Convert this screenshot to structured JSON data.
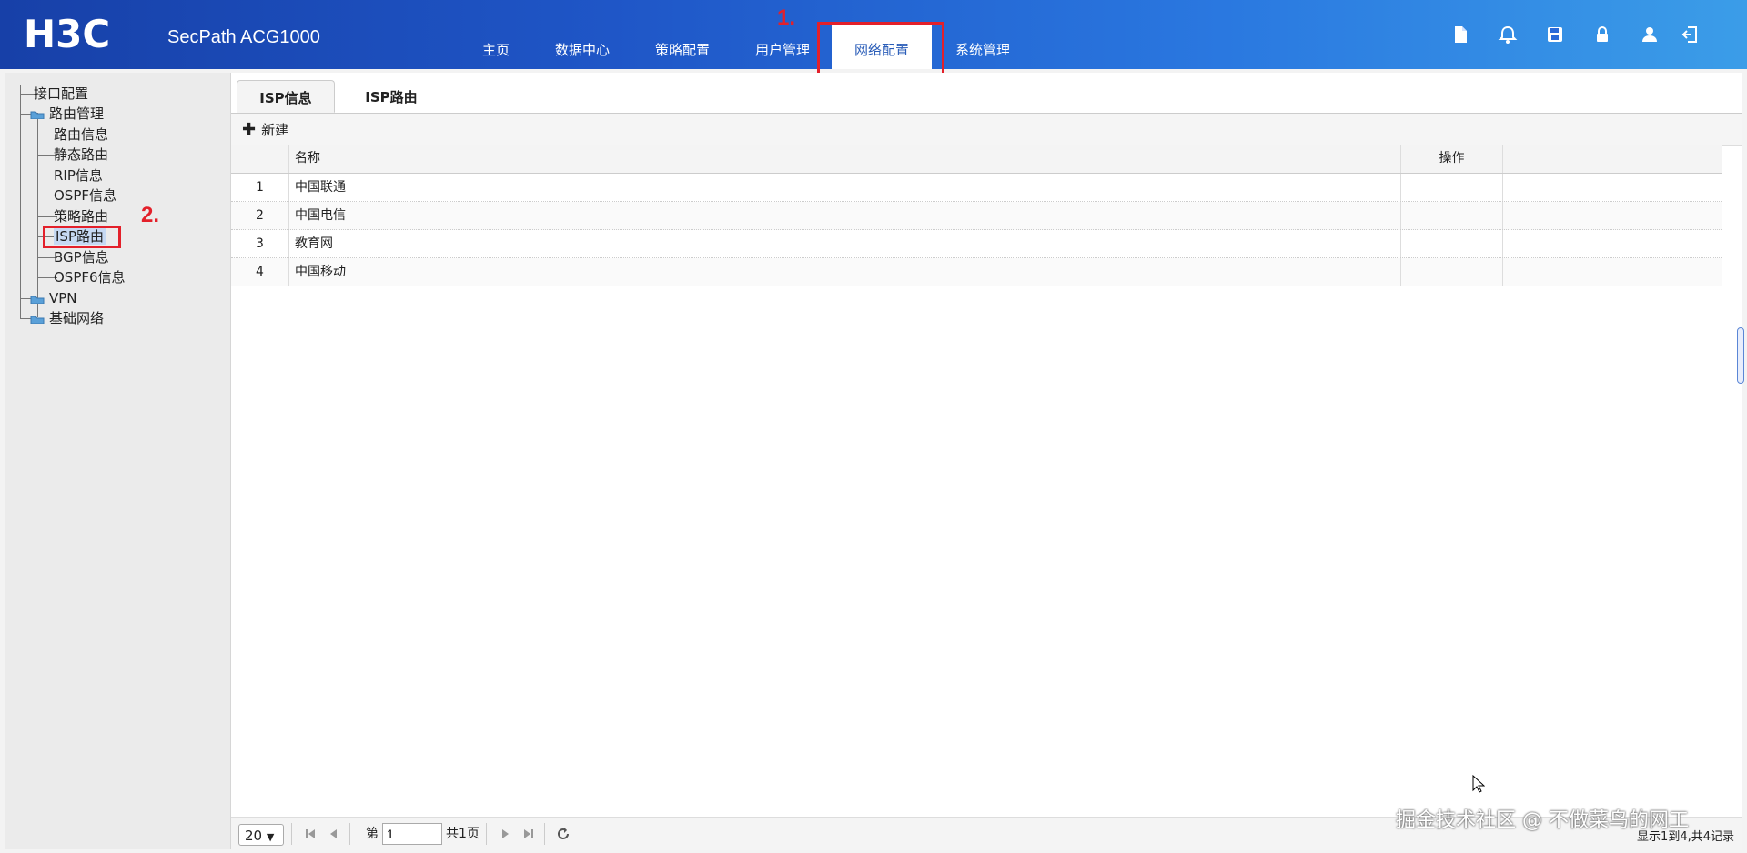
{
  "header": {
    "logo_text": "H3C",
    "product": "SecPath ACG1000",
    "nav": [
      "主页",
      "数据中心",
      "策略配置",
      "用户管理",
      "网络配置",
      "系统管理"
    ],
    "active_nav": "网络配置",
    "icons": [
      "document-icon",
      "bell-icon",
      "save-icon",
      "lock-icon",
      "user-icon",
      "logout-icon"
    ]
  },
  "annotations": {
    "step1": "1.",
    "step2": "2."
  },
  "sidebar": {
    "items": [
      {
        "label": "接口配置",
        "level": 0
      },
      {
        "label": "路由管理",
        "level": 0,
        "folder": true
      },
      {
        "label": "路由信息",
        "level": 1
      },
      {
        "label": "静态路由",
        "level": 1
      },
      {
        "label": "RIP信息",
        "level": 1
      },
      {
        "label": "OSPF信息",
        "level": 1
      },
      {
        "label": "策略路由",
        "level": 1
      },
      {
        "label": "ISP路由",
        "level": 1,
        "selected": true
      },
      {
        "label": "BGP信息",
        "level": 1
      },
      {
        "label": "OSPF6信息",
        "level": 1
      },
      {
        "label": "VPN",
        "level": 0,
        "folder": true
      },
      {
        "label": "基础网络",
        "level": 0,
        "folder": true
      }
    ]
  },
  "tabs": [
    "ISP信息",
    "ISP路由"
  ],
  "active_tab": "ISP信息",
  "toolbar": {
    "new_label": "新建"
  },
  "grid": {
    "columns": [
      "名称",
      "操作"
    ],
    "rows": [
      {
        "idx": "1",
        "name": "中国联通"
      },
      {
        "idx": "2",
        "name": "中国电信"
      },
      {
        "idx": "3",
        "name": "教育网"
      },
      {
        "idx": "4",
        "name": "中国移动"
      }
    ]
  },
  "pagination": {
    "page_size": "20",
    "page_prefix": "第",
    "page": "1",
    "total_pages": "共1页",
    "record_info": "显示1到4,共4记录"
  },
  "watermark": "掘金技术社区 @ 不做菜鸟的网工",
  "colors": {
    "accent": "#2a5db8",
    "annotation": "#e3202a"
  }
}
